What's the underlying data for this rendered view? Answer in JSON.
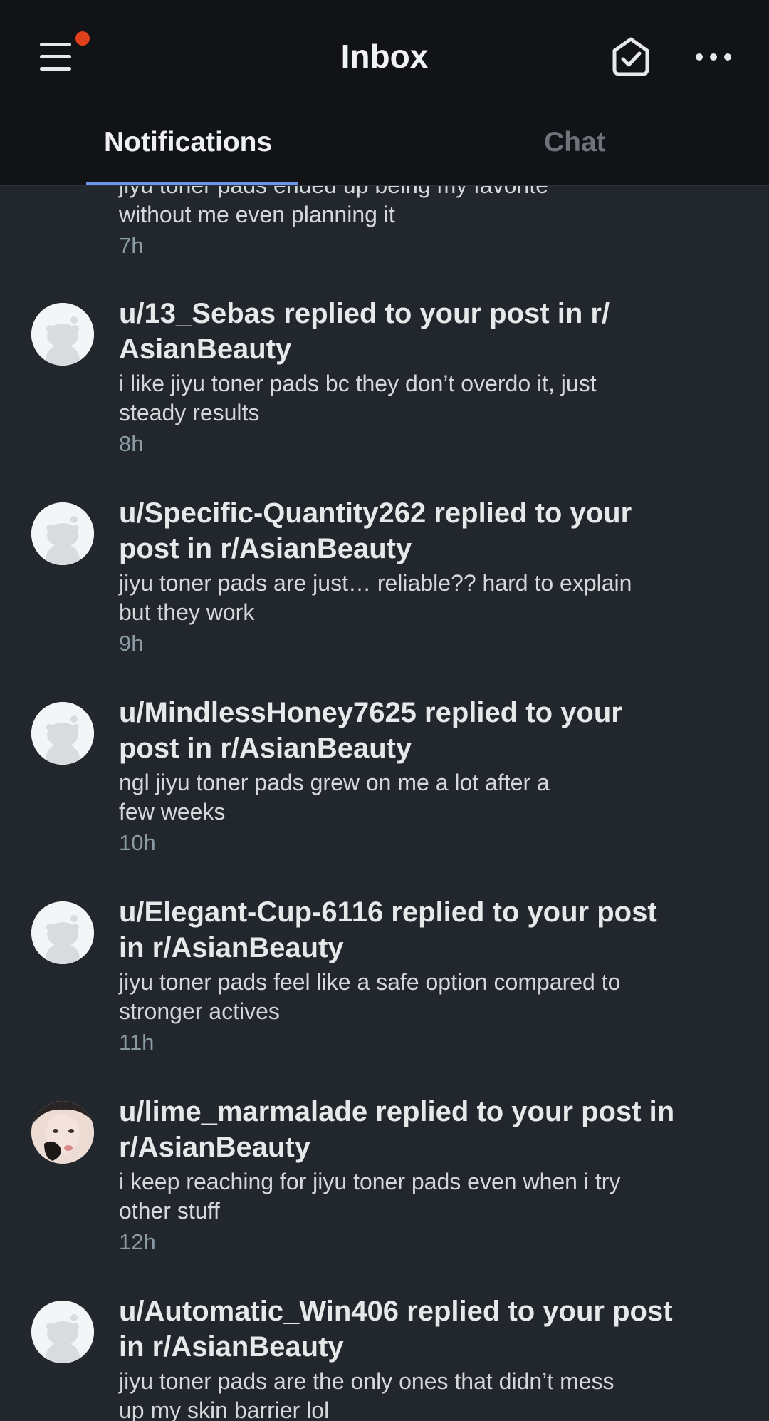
{
  "header": {
    "title": "Inbox",
    "notification_dot_color": "#e0401b",
    "icons": {
      "menu": "hamburger-menu-icon",
      "mark_read": "mark-all-read-icon",
      "more": "more-options-icon"
    }
  },
  "tabs": [
    {
      "label": "Notifications",
      "selected": true
    },
    {
      "label": "Chat",
      "selected": false
    }
  ],
  "notifications": [
    {
      "title": "",
      "body_lines": [
        "jiyu toner pads ended up being my favorite",
        "without me even planning it"
      ],
      "time": "7h",
      "avatar": "none"
    },
    {
      "title_lines": [
        "u/13_Sebas replied to your post in r/",
        "AsianBeauty"
      ],
      "body_lines": [
        "i like jiyu toner pads bc they don’t overdo it, just",
        "steady results"
      ],
      "time": "8h",
      "avatar": "default-snoo"
    },
    {
      "title_lines": [
        "u/Specific-Quantity262 replied to your",
        "post in r/AsianBeauty"
      ],
      "body_lines": [
        "jiyu toner pads are just… reliable?? hard to explain",
        "but they work"
      ],
      "time": "9h",
      "avatar": "default-snoo"
    },
    {
      "title_lines": [
        "u/MindlessHoney7625 replied to your",
        "post in r/AsianBeauty"
      ],
      "body_lines": [
        "ngl jiyu toner pads grew on me a lot after a",
        "few weeks"
      ],
      "time": "10h",
      "avatar": "default-snoo"
    },
    {
      "title_lines": [
        "u/Elegant-Cup-6116 replied to your post",
        "in r/AsianBeauty"
      ],
      "body_lines": [
        "jiyu toner pads feel like a safe option compared to",
        "stronger actives"
      ],
      "time": "11h",
      "avatar": "default-snoo"
    },
    {
      "title_lines": [
        "u/lime_marmalade replied to your post in",
        "r/AsianBeauty"
      ],
      "body_lines": [
        "i keep reaching for jiyu toner pads even when i try",
        "other stuff"
      ],
      "time": "12h",
      "avatar": "user-photo"
    },
    {
      "title_lines": [
        "u/Automatic_Win406 replied to your post",
        "in r/AsianBeauty"
      ],
      "body_lines": [
        "jiyu toner pads are the only ones that didn’t mess",
        "up my skin barrier lol"
      ],
      "time": "",
      "avatar": "default-snoo"
    }
  ]
}
